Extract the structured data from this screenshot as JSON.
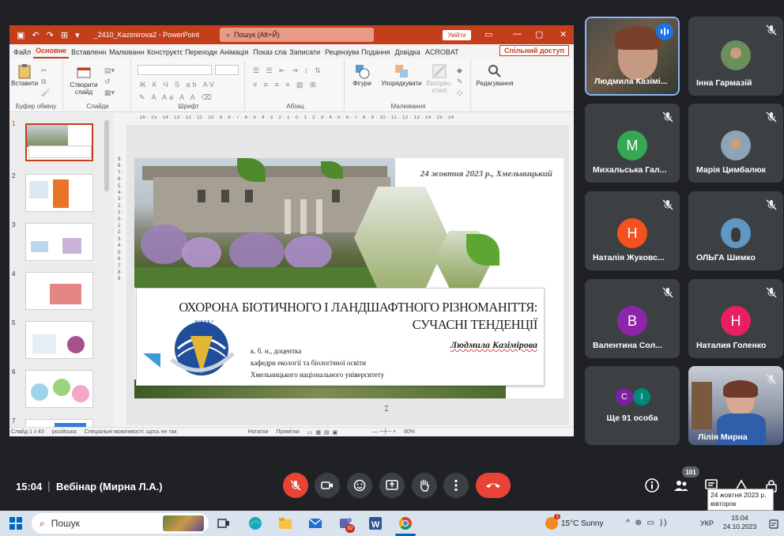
{
  "powerpoint": {
    "filename": "_2410_Kazimirova2  -  PowerPoint",
    "search_placeholder": "Пошук (Alt+Й)",
    "signin_label": "Увійти",
    "tabs": [
      "Файл",
      "Основне",
      "Вставлення",
      "Малювання",
      "Конструктор",
      "Переходи",
      "Анімація",
      "Показ слайдів",
      "Записати",
      "Рецензування",
      "Подання",
      "Довідка",
      "ACROBAT"
    ],
    "active_tab": "Основне",
    "share_label": "Спільний доступ",
    "ribbon": {
      "paste": "Вставити",
      "clipboard": "Буфер обміну",
      "new_slide": "Створити слайд",
      "slides": "Слайди",
      "font": "Шрифт",
      "paragraph": "Абзац",
      "shapes": "Фігури",
      "arrange": "Упорядкувати",
      "quick_styles": "Експрес-стилі",
      "drawing": "Малювання",
      "editing": "Редагування"
    },
    "ruler_h": "· 16 · 15 · 14 · 13 · 12 · 11 · 10 · 9 · 8 · 7 · 6 · 5 · 4 · 3 · 2 · 1 · 0 · 1 · 2 · 3 · 4 · 5 · 6 · 7 · 8 · 9 · 10 · 11 · 12 · 13 · 14 · 15 · 16 ·",
    "ruler_v": "9·8·7·6·5·4·3·2·1·0·1·2·3·4·5·6·7·8·9",
    "thumbs": [
      "1",
      "2",
      "3",
      "4",
      "5",
      "6",
      "7"
    ],
    "status": {
      "slide": "Слайд 1 з 43",
      "lang": "російська",
      "accessibility": "Спеціальні можливості: щось не так",
      "notes": "Нотатки",
      "comments": "Примітки",
      "zoom": "60%"
    }
  },
  "slide": {
    "date": "24 жовтня 2023 р., Хмельницький",
    "title_line1": "ОХОРОНА БІОТИЧНОГО І ЛАНДШАФТНОГО РІЗНОМАНІТТЯ:",
    "title_line2": "СУЧАСНІ ТЕНДЕНЦІЇ",
    "author": "Людмила Казімірова",
    "degree": "к. б. н., доцентка",
    "department": "кафедри екології та біологічної освіти",
    "university": "Хмельницького національного університету",
    "logo_text": "ХНУ"
  },
  "participants": [
    {
      "name": "Людмила Казімі...",
      "type": "video",
      "speaking": true
    },
    {
      "name": "Інна Гармазій",
      "type": "photo"
    },
    {
      "name": "Михальська Гал...",
      "type": "letter",
      "letter": "М",
      "color": "#34a853"
    },
    {
      "name": "Марія Цимбалюк",
      "type": "photo"
    },
    {
      "name": "Наталія Жуковс...",
      "type": "letter",
      "letter": "Н",
      "color": "#f4511e"
    },
    {
      "name": "ОЛЬГА Шимко",
      "type": "photo"
    },
    {
      "name": "Валентина Сол...",
      "type": "letter",
      "letter": "В",
      "color": "#8e24aa"
    },
    {
      "name": "Наталия Голенко",
      "type": "letter",
      "letter": "Н",
      "color": "#e91e63"
    },
    {
      "name": "Ще 91 особа",
      "type": "more",
      "letters": [
        "С",
        "І"
      ]
    },
    {
      "name": "Лілія Мирна",
      "type": "video"
    }
  ],
  "meet": {
    "time": "15:04",
    "separator": "|",
    "title": "Вебінар (Мирна Л.А.)",
    "people_count": "101"
  },
  "tooltip": {
    "line1": "24 жовтня 2023 р.",
    "line2": "вівторок"
  },
  "taskbar": {
    "search_placeholder": "Пошук",
    "teams_badge": "32",
    "weather_badge": "1",
    "weather": "15°C  Sunny",
    "tray": "^ ⊕ ▭ ))",
    "lang": "УКР",
    "time": "15:04",
    "date": "24.10.2023"
  }
}
